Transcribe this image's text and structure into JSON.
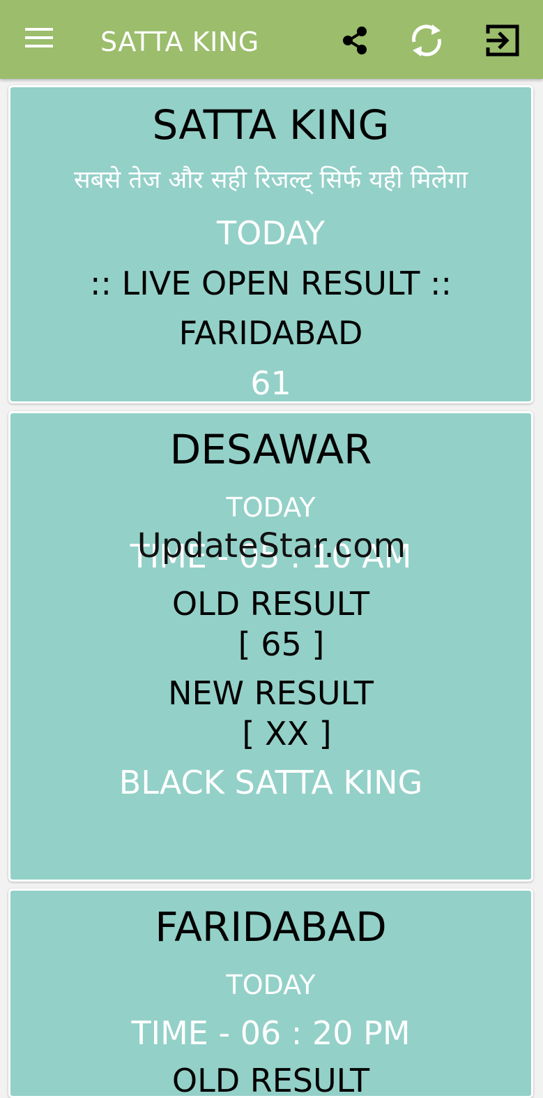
{
  "app_bar": {
    "title": "SATTA KING",
    "background": "#9bbd6c",
    "icons": [
      "menu-icon",
      "share-icon",
      "refresh-icon",
      "exit-icon"
    ]
  },
  "header_card": {
    "title": "SATTA KING",
    "tagline": "सबसे तेज और सही रिजल्ट् सिर्फ यही मिलेगा",
    "today": "TODAY",
    "live_label": ":: LIVE OPEN RESULT ::",
    "game": "FARIDABAD",
    "result": "61"
  },
  "desawar_card": {
    "title": "DESAWAR",
    "today": "TODAY",
    "time": "TIME - 05 : 10 AM",
    "old_label": "OLD RESULT",
    "old_value": "[ 65 ]",
    "new_label": "NEW RESULT",
    "new_value": "[ XX ]",
    "footer": "BLACK SATTA KING"
  },
  "faridabad_card": {
    "title": "FARIDABAD",
    "today": "TODAY",
    "time": "TIME - 06 : 20 PM",
    "old_label": "OLD RESULT"
  },
  "watermark": "UpdateStar.com",
  "colors": {
    "card_bg": "#93d0c8",
    "page_bg": "#f2f2f2",
    "accent": "#9bbd6c"
  }
}
